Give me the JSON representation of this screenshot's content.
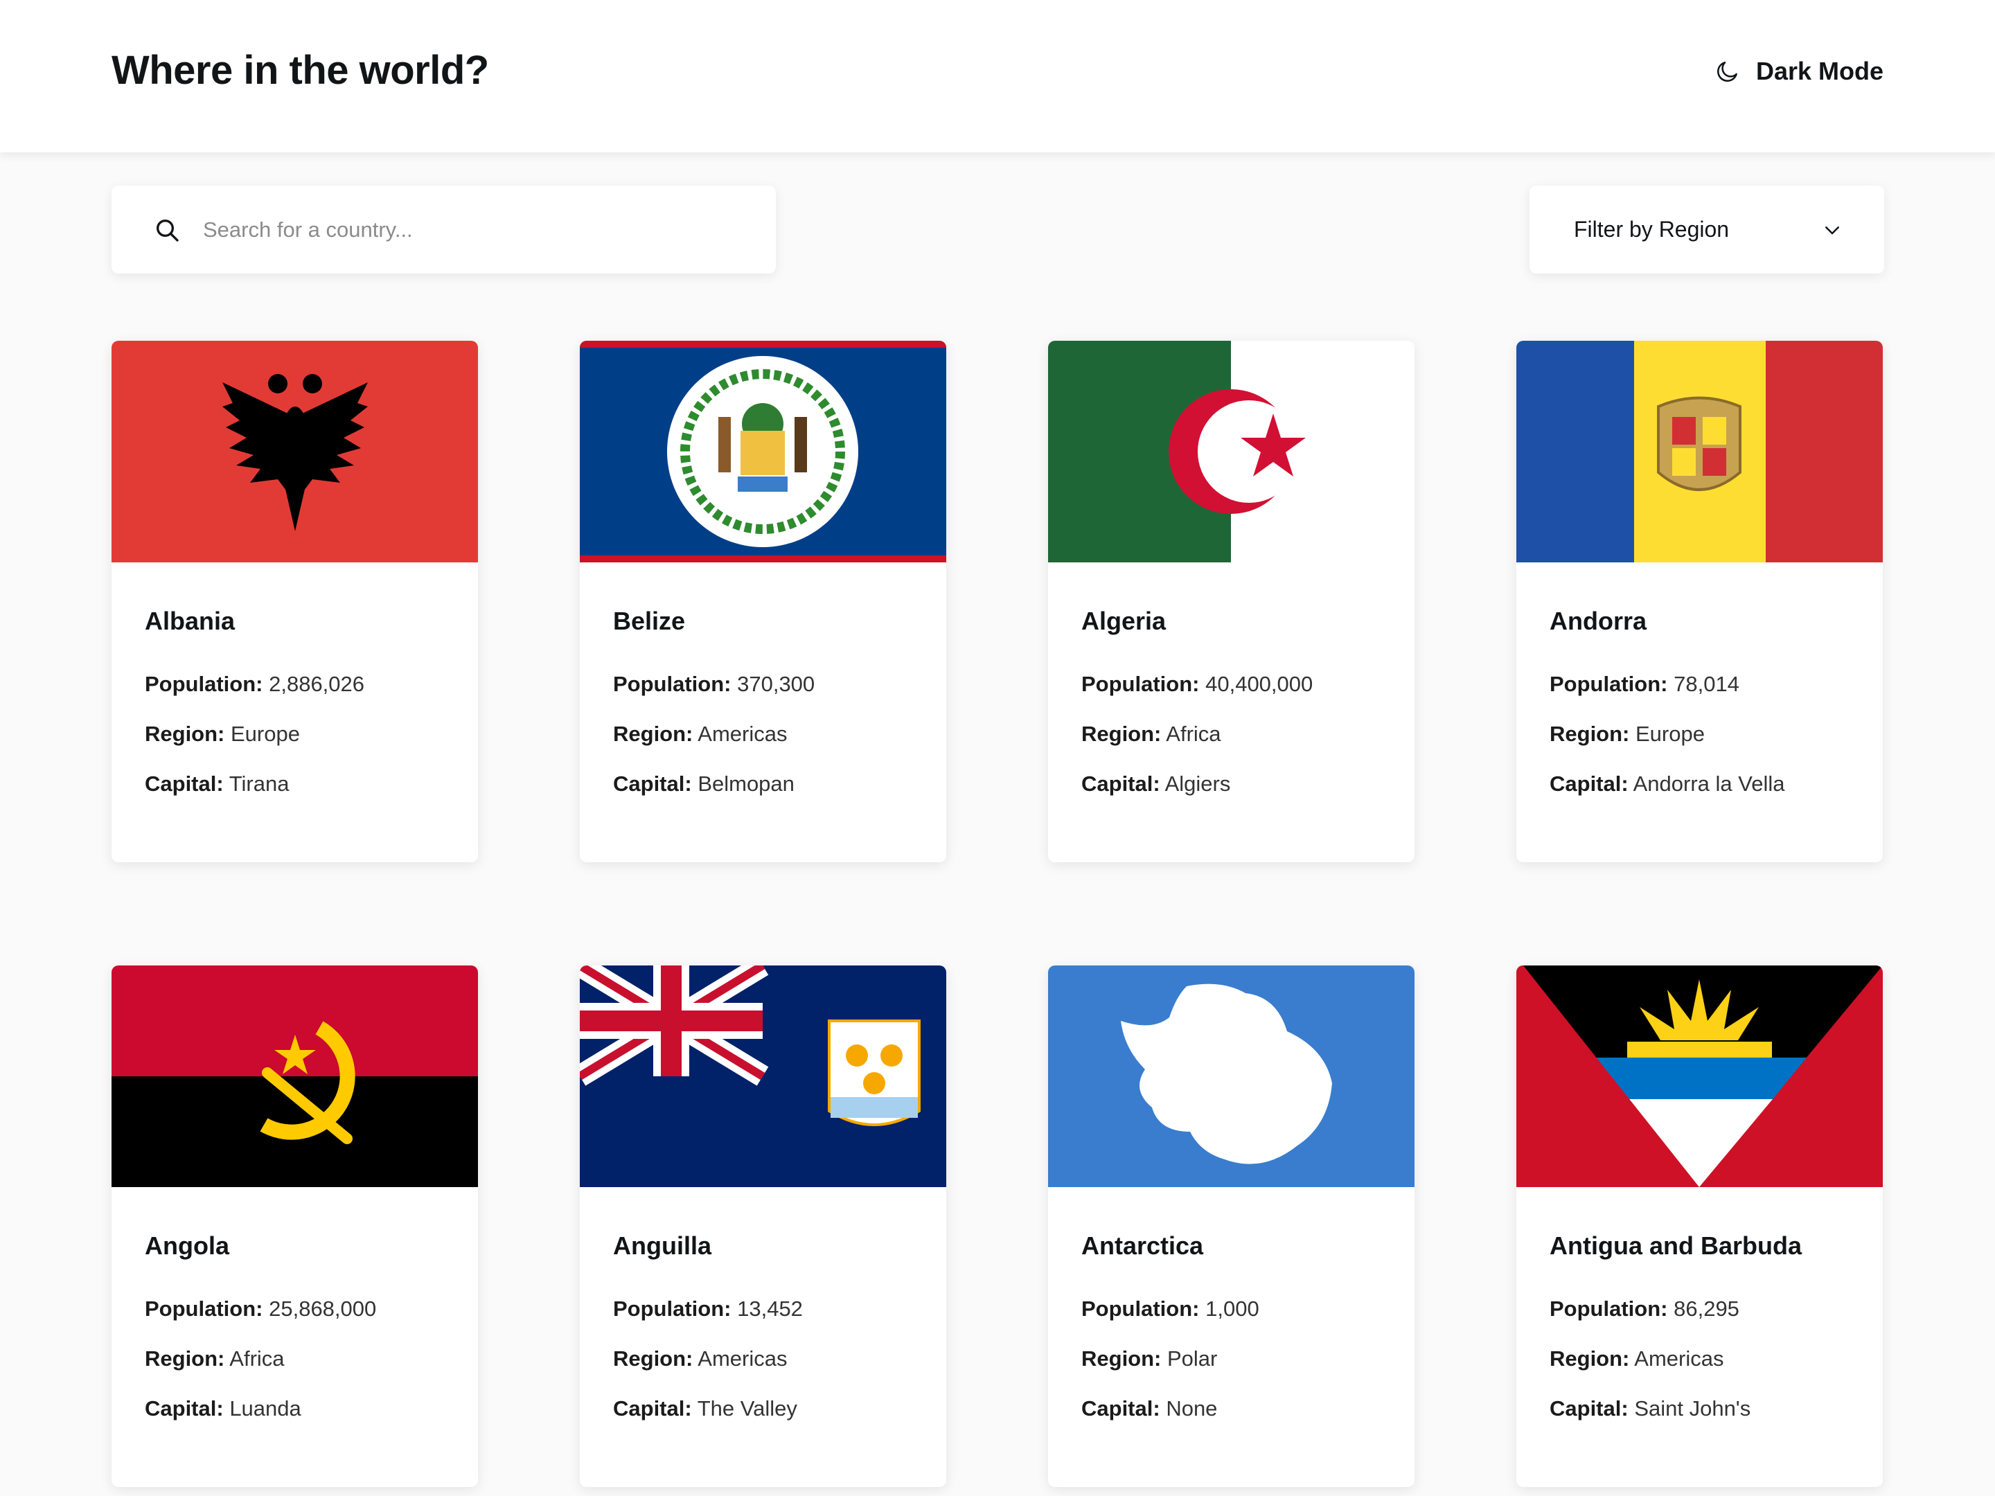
{
  "header": {
    "title": "Where in the world?",
    "dark_mode_label": "Dark Mode"
  },
  "search": {
    "placeholder": "Search for a country..."
  },
  "filter": {
    "label": "Filter by Region"
  },
  "labels": {
    "population": "Population:",
    "region": "Region:",
    "capital": "Capital:"
  },
  "countries": [
    {
      "name": "Albania",
      "population": "2,886,026",
      "region": "Europe",
      "capital": "Tirana"
    },
    {
      "name": "Belize",
      "population": "370,300",
      "region": "Americas",
      "capital": "Belmopan"
    },
    {
      "name": "Algeria",
      "population": "40,400,000",
      "region": "Africa",
      "capital": "Algiers"
    },
    {
      "name": "Andorra",
      "population": "78,014",
      "region": "Europe",
      "capital": "Andorra la Vella"
    },
    {
      "name": "Angola",
      "population": "25,868,000",
      "region": "Africa",
      "capital": "Luanda"
    },
    {
      "name": "Anguilla",
      "population": "13,452",
      "region": "Americas",
      "capital": "The Valley"
    },
    {
      "name": "Antarctica",
      "population": "1,000",
      "region": "Polar",
      "capital": "None"
    },
    {
      "name": "Antigua and Barbuda",
      "population": "86,295",
      "region": "Americas",
      "capital": "Saint John's"
    }
  ],
  "icons": {
    "moon": "moon-icon",
    "search": "search-icon",
    "chevron": "chevron-down-icon"
  },
  "colors": {
    "background": "#fafafa",
    "surface": "#ffffff",
    "text": "#111517"
  }
}
